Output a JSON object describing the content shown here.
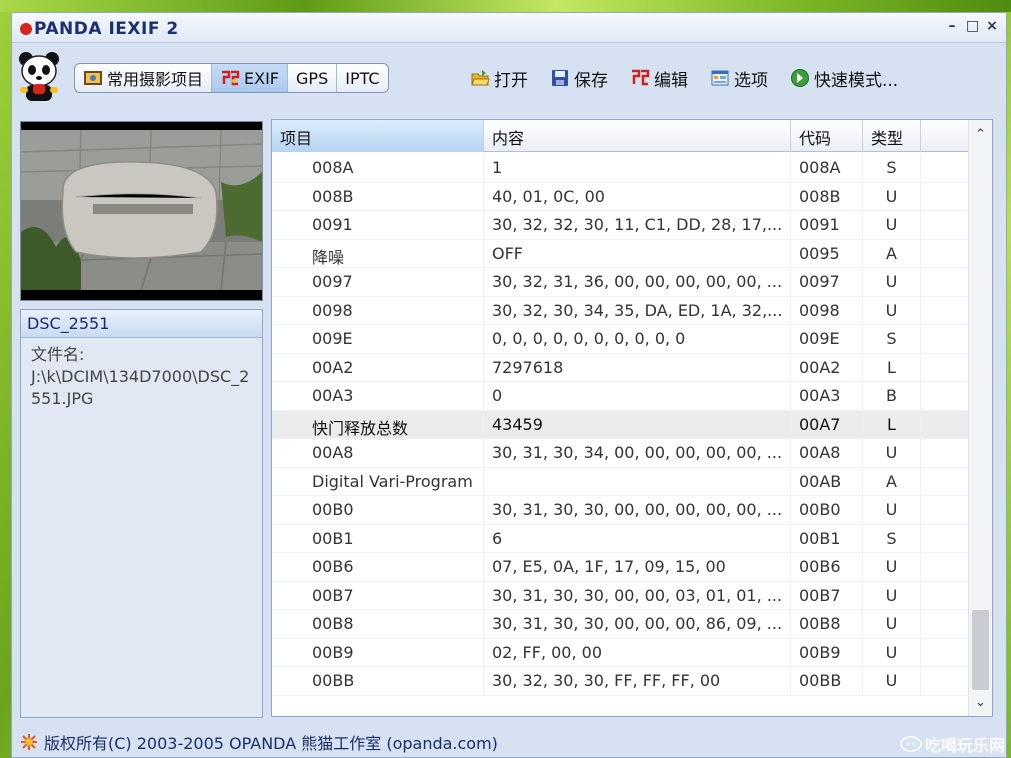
{
  "window": {
    "title": "PANDA IEXIF 2",
    "controls": [
      "–",
      "□",
      "×"
    ]
  },
  "toolbar": {
    "tabs": [
      {
        "label": "常用摄影项目",
        "icon": "camera-icon",
        "active": false
      },
      {
        "label": "EXIF",
        "icon": "exif-icon",
        "active": true
      },
      {
        "label": "GPS",
        "icon": "",
        "active": false
      },
      {
        "label": "IPTC",
        "icon": "",
        "active": false
      }
    ],
    "actions": [
      {
        "label": "打开",
        "icon": "open-folder-icon"
      },
      {
        "label": "保存",
        "icon": "save-disk-icon"
      },
      {
        "label": "编辑",
        "icon": "edit-icon"
      },
      {
        "label": "选项",
        "icon": "options-icon"
      },
      {
        "label": "快速模式...",
        "icon": "quick-mode-icon"
      }
    ]
  },
  "info": {
    "filename_title": "DSC_2551",
    "file_label": "文件名:",
    "file_path": "J:\\k\\DCIM\\134D7000\\DSC_2551.JPG"
  },
  "grid": {
    "columns": [
      "项目",
      "内容",
      "代码",
      "类型",
      ""
    ],
    "rows": [
      {
        "item": "008A",
        "content": "1",
        "code": "008A",
        "type": "S"
      },
      {
        "item": "008B",
        "content": "40, 01, 0C, 00",
        "code": "008B",
        "type": "U"
      },
      {
        "item": "0091",
        "content": "30, 32, 32, 30, 11, C1, DD, 28, 17,...",
        "code": "0091",
        "type": "U"
      },
      {
        "item": "降噪",
        "content": "OFF",
        "code": "0095",
        "type": "A"
      },
      {
        "item": "0097",
        "content": "30, 32, 31, 36, 00, 00, 00, 00, 00, ...",
        "code": "0097",
        "type": "U"
      },
      {
        "item": "0098",
        "content": "30, 32, 30, 34, 35, DA, ED, 1A, 32,...",
        "code": "0098",
        "type": "U"
      },
      {
        "item": "009E",
        "content": "0, 0, 0, 0, 0, 0, 0, 0, 0, 0",
        "code": "009E",
        "type": "S"
      },
      {
        "item": "00A2",
        "content": "7297618",
        "code": "00A2",
        "type": "L"
      },
      {
        "item": "00A3",
        "content": "0",
        "code": "00A3",
        "type": "B"
      },
      {
        "item": "快门释放总数",
        "content": "43459",
        "code": "00A7",
        "type": "L",
        "highlight": true
      },
      {
        "item": "00A8",
        "content": "30, 31, 30, 34, 00, 00, 00, 00, 00, ...",
        "code": "00A8",
        "type": "U"
      },
      {
        "item": "Digital Vari-Program",
        "content": "",
        "code": "00AB",
        "type": "A"
      },
      {
        "item": "00B0",
        "content": "30, 31, 30, 30, 00, 00, 00, 00, 00, ...",
        "code": "00B0",
        "type": "U"
      },
      {
        "item": "00B1",
        "content": "6",
        "code": "00B1",
        "type": "S"
      },
      {
        "item": "00B6",
        "content": "07, E5, 0A, 1F, 17, 09, 15, 00",
        "code": "00B6",
        "type": "U"
      },
      {
        "item": "00B7",
        "content": "30, 31, 30, 30, 00, 00, 03, 01, 01, ...",
        "code": "00B7",
        "type": "U"
      },
      {
        "item": "00B8",
        "content": "30, 31, 30, 30, 00, 00, 00, 86, 09, ...",
        "code": "00B8",
        "type": "U"
      },
      {
        "item": "00B9",
        "content": "02, FF, 00, 00",
        "code": "00B9",
        "type": "U"
      },
      {
        "item": "00BB",
        "content": "30, 32, 30, 30, FF, FF, FF, 00",
        "code": "00BB",
        "type": "U"
      }
    ]
  },
  "status": {
    "copyright": "版权所有(C) 2003-2005 OPANDA 熊猫工作室 (opanda.com)"
  },
  "watermark": {
    "text": "吃喝玩乐网"
  },
  "colors": {
    "accent": "#1b2f74",
    "selected_tab": "#b6d3f3",
    "highlight_row": "#ececec"
  }
}
